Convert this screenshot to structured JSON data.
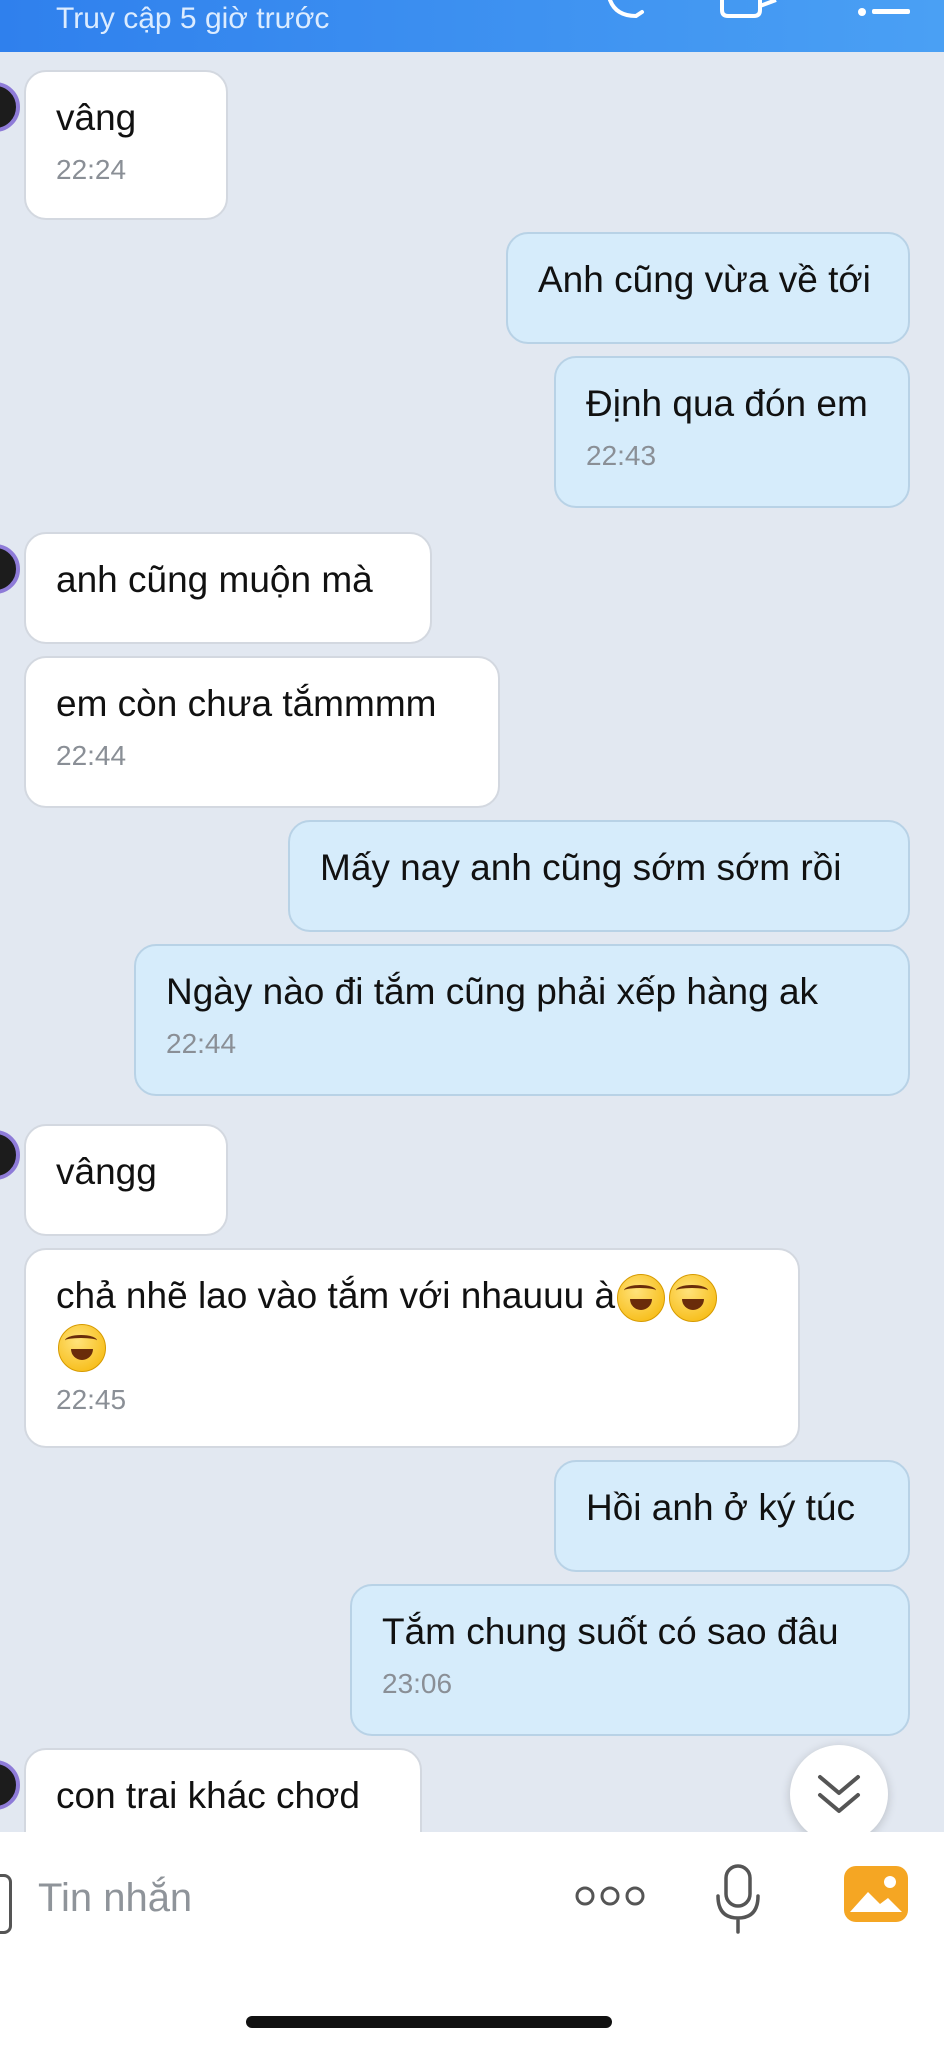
{
  "header": {
    "status": "Truy cập 5 giờ trước",
    "icons": [
      "phone-icon",
      "video-call-icon",
      "menu-icon"
    ]
  },
  "messages": [
    {
      "side": "in",
      "text": "vâng",
      "time": "22:24"
    },
    {
      "side": "out",
      "text": "Anh cũng vừa về tới",
      "time": ""
    },
    {
      "side": "out",
      "text": "Định qua đón em",
      "time": "22:43"
    },
    {
      "side": "in",
      "text": "anh cũng muộn mà",
      "time": ""
    },
    {
      "side": "in",
      "text": "em còn chưa tắmmmm",
      "time": "22:44"
    },
    {
      "side": "out",
      "text": "Mấy nay anh cũng sớm sớm rồi",
      "time": ""
    },
    {
      "side": "out",
      "text": "Ngày nào đi tắm cũng phải xếp hàng ak",
      "time": "22:44"
    },
    {
      "side": "in",
      "text": "vângg",
      "time": ""
    },
    {
      "side": "in",
      "text": "chả nhẽ lao vào tắm với nhauuu à",
      "emojis": 3,
      "time": "22:45"
    },
    {
      "side": "out",
      "text": "Hồi anh ở ký túc",
      "time": ""
    },
    {
      "side": "out",
      "text": "Tắm chung suốt có sao đâu",
      "time": "23:06"
    },
    {
      "side": "in",
      "text": "con trai khác chơd",
      "time": ""
    }
  ],
  "input": {
    "placeholder": "Tin nhắn",
    "icons": [
      "more-options-icon",
      "microphone-icon",
      "gallery-icon"
    ]
  },
  "scroll_button": {
    "icon": "double-chevron-down-icon"
  },
  "colors": {
    "header": "#2f80ed",
    "background": "#e2e8f1",
    "outgoing_bubble": "#d6ecfb",
    "incoming_bubble": "#ffffff",
    "gallery_icon": "#f5a623"
  }
}
